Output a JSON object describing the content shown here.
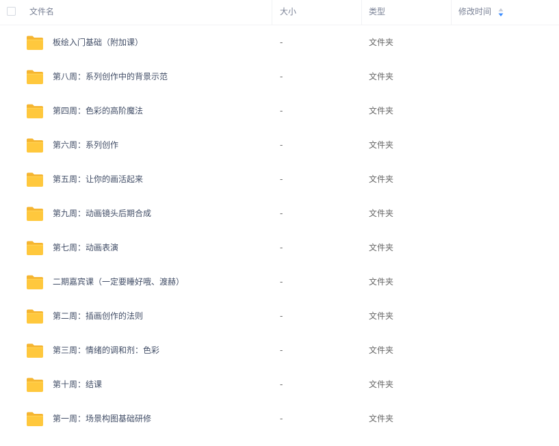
{
  "header": {
    "name_label": "文件名",
    "size_label": "大小",
    "type_label": "类型",
    "time_label": "修改时间",
    "sort_icon": "sort-arrows-icon",
    "accent_color": "#3b8cff"
  },
  "folder_icon": "folder-icon",
  "folder_color": "#ffc83d",
  "rows": [
    {
      "name": "板绘入门基础（附加课）",
      "size": "-",
      "type": "文件夹",
      "time": ""
    },
    {
      "name": "第八周：系列创作中的背景示范",
      "size": "-",
      "type": "文件夹",
      "time": ""
    },
    {
      "name": "第四周：色彩的高阶魔法",
      "size": "-",
      "type": "文件夹",
      "time": ""
    },
    {
      "name": "第六周：系列创作",
      "size": "-",
      "type": "文件夹",
      "time": ""
    },
    {
      "name": "第五周：让你的画活起来",
      "size": "-",
      "type": "文件夹",
      "time": ""
    },
    {
      "name": "第九周：动画镜头后期合成",
      "size": "-",
      "type": "文件夹",
      "time": ""
    },
    {
      "name": "第七周：动画表演",
      "size": "-",
      "type": "文件夹",
      "time": ""
    },
    {
      "name": "二期嘉宾课（一定要睡好哦、渡赫）",
      "size": "-",
      "type": "文件夹",
      "time": ""
    },
    {
      "name": "第二周：插画创作的法则",
      "size": "-",
      "type": "文件夹",
      "time": ""
    },
    {
      "name": "第三周：情绪的调和剂：色彩",
      "size": "-",
      "type": "文件夹",
      "time": ""
    },
    {
      "name": "第十周：结课",
      "size": "-",
      "type": "文件夹",
      "time": ""
    },
    {
      "name": "第一周：场景构图基础研修",
      "size": "-",
      "type": "文件夹",
      "time": ""
    }
  ]
}
